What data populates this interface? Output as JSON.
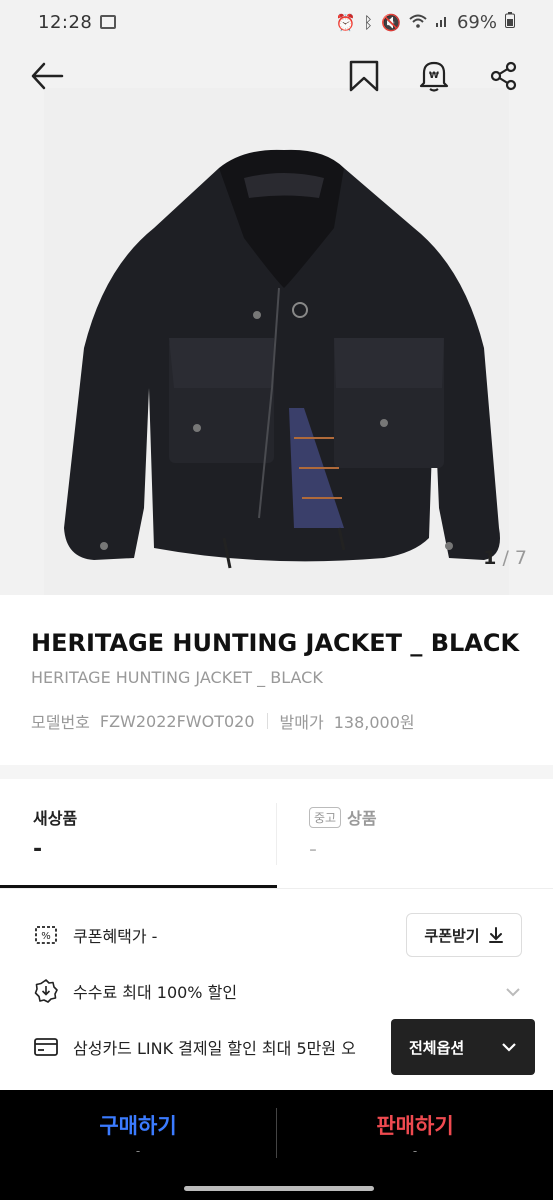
{
  "status_bar": {
    "time": "12:28",
    "battery": "69%",
    "icons": [
      "gallery-icon",
      "alarm-icon",
      "bluetooth-icon",
      "mute-icon",
      "wifi-icon",
      "signal-icon",
      "battery-icon"
    ]
  },
  "header": {
    "back_icon": "back-arrow-icon",
    "bookmark_icon": "bookmark-icon",
    "alert_icon": "price-alert-icon",
    "share_icon": "share-icon"
  },
  "gallery": {
    "current": "1",
    "separator": "/",
    "total": "7"
  },
  "product": {
    "title": "HERITAGE HUNTING JACKET _ BLACK",
    "subtitle": "HERITAGE HUNTING JACKET _ BLACK",
    "model_label": "모델번호",
    "model_value": "FZW2022FWOT020",
    "release_label": "발매가",
    "release_value": "138,000원"
  },
  "tabs": {
    "new": {
      "label": "새상품",
      "price": "-"
    },
    "used": {
      "badge": "중고",
      "label": "상품",
      "price": "-"
    }
  },
  "benefits": {
    "coupon": {
      "text": "쿠폰혜택가 -",
      "button": "쿠폰받기"
    },
    "fee": {
      "text": "수수료 최대 100% 할인"
    },
    "card": {
      "text": "삼성카드 LINK 결제일 할인 최대 5만원 오"
    }
  },
  "options_button": "전체옵션",
  "actions": {
    "buy": {
      "label": "구매하기",
      "sub": "-"
    },
    "sell": {
      "label": "판매하기",
      "sub": "-"
    }
  },
  "colors": {
    "buy": "#3b7bff",
    "sell": "#ef4a50",
    "bottom_bar": "#000000"
  }
}
